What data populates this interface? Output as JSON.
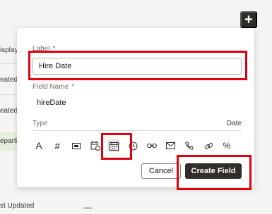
{
  "background": {
    "rows": [
      "isplay",
      "eated",
      "eated",
      "eparti",
      "st Updated"
    ]
  },
  "toolbar": {
    "add_button_label": "+"
  },
  "form": {
    "label": {
      "title": "Label",
      "required_mark": "*",
      "value": "Hire Date"
    },
    "field_name": {
      "title": "Field Name",
      "required_mark": "*",
      "value": "hireDate"
    },
    "type": {
      "title": "Type",
      "selected_value": "Date",
      "icons": [
        {
          "name": "text-type-icon",
          "glyph": "A"
        },
        {
          "name": "number-type-icon",
          "glyph": "#"
        },
        {
          "name": "id-card-type-icon",
          "glyph": "id"
        },
        {
          "name": "datetime-type-icon",
          "glyph": "dt"
        },
        {
          "name": "date-type-icon",
          "glyph": "cal",
          "selected": true
        },
        {
          "name": "time-type-icon",
          "glyph": "clock"
        },
        {
          "name": "link-type-icon",
          "glyph": "link"
        },
        {
          "name": "email-type-icon",
          "glyph": "mail"
        },
        {
          "name": "phone-type-icon",
          "glyph": "phone"
        },
        {
          "name": "url-type-icon",
          "glyph": "chain"
        },
        {
          "name": "percent-type-icon",
          "glyph": "%"
        }
      ]
    }
  },
  "actions": {
    "cancel_label": "Cancel",
    "create_label": "Create Field"
  },
  "colors": {
    "highlight": "#e3000f",
    "primary_button": "#312d2a"
  }
}
